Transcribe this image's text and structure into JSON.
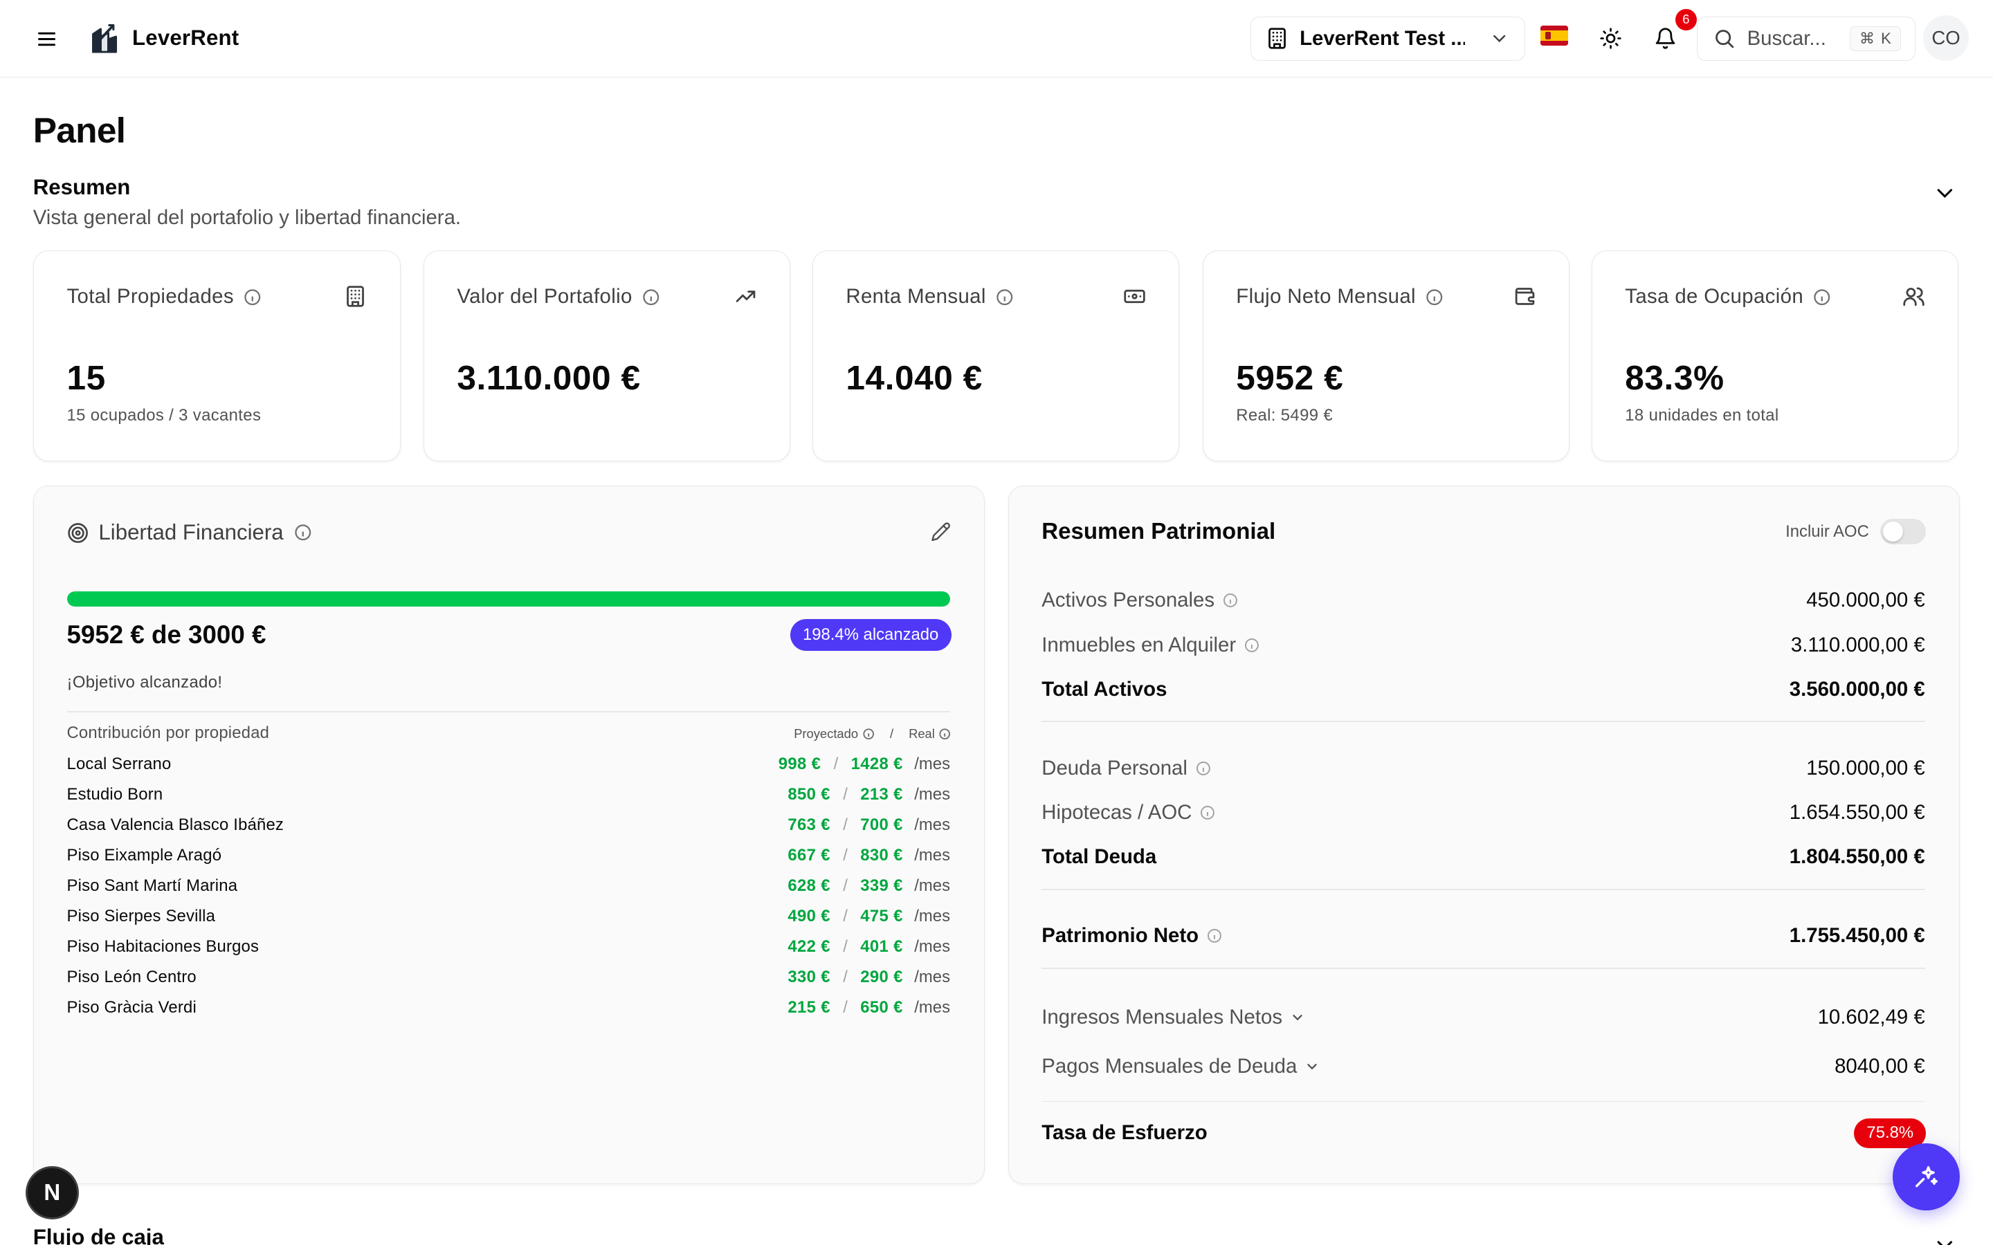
{
  "header": {
    "brand": "LeverRent",
    "org": "LeverRent Test ...",
    "notifications_count": "6",
    "search_placeholder": "Buscar...",
    "shortcut_symbol": "⌘",
    "shortcut_key": "K",
    "avatar_initials": "CO",
    "icons": [
      "menu-icon",
      "logo-icon",
      "building-icon",
      "chevron-down-icon",
      "spain-flag-icon",
      "sun-icon",
      "bell-icon",
      "search-icon"
    ]
  },
  "page": {
    "title": "Panel",
    "summary_title": "Resumen",
    "summary_subtitle": "Vista general del portafolio y libertad financiera."
  },
  "cards": [
    {
      "label": "Total Propiedades",
      "value": "15",
      "sub": "15 ocupados / 3 vacantes",
      "icon": "building-icon"
    },
    {
      "label": "Valor del Portafolio",
      "value": "3.110.000 €",
      "sub": "",
      "icon": "trending-up-icon"
    },
    {
      "label": "Renta Mensual",
      "value": "14.040 €",
      "sub": "",
      "icon": "banknote-icon"
    },
    {
      "label": "Flujo Neto Mensual",
      "value": "5952 €",
      "sub": "Real: 5499 €",
      "icon": "wallet-icon"
    },
    {
      "label": "Tasa de Ocupación",
      "value": "83.3%",
      "sub": "18 unidades en total",
      "icon": "users-icon"
    }
  ],
  "financial_freedom": {
    "title": "Libertad Financiera",
    "progress_fraction": 1.0,
    "amount": "5952 € de 3000 €",
    "badge": "198.4% alcanzado",
    "message": "¡Objetivo alcanzado!",
    "contrib_title": "Contribución por propiedad",
    "legend_projected": "Proyectado",
    "legend_sep": "/",
    "legend_real": "Real",
    "per": "/mes",
    "rows": [
      {
        "name": "Local Serrano",
        "projected": "998 €",
        "real": "1428 €"
      },
      {
        "name": "Estudio Born",
        "projected": "850 €",
        "real": "213 €"
      },
      {
        "name": "Casa Valencia Blasco Ibáñez",
        "projected": "763 €",
        "real": "700 €"
      },
      {
        "name": "Piso Eixample Aragó",
        "projected": "667 €",
        "real": "830 €"
      },
      {
        "name": "Piso Sant Martí Marina",
        "projected": "628 €",
        "real": "339 €"
      },
      {
        "name": "Piso Sierpes Sevilla",
        "projected": "490 €",
        "real": "475 €"
      },
      {
        "name": "Piso Habitaciones Burgos",
        "projected": "422 €",
        "real": "401 €"
      },
      {
        "name": "Piso León Centro",
        "projected": "330 €",
        "real": "290 €"
      },
      {
        "name": "Piso Gràcia Verdi",
        "projected": "215 €",
        "real": "650 €"
      }
    ]
  },
  "patrimony": {
    "title": "Resumen Patrimonial",
    "include_aoc": "Incluir AOC",
    "include_aoc_on": false,
    "personal_assets_label": "Activos Personales",
    "personal_assets": "450.000,00 €",
    "rental_label": "Inmuebles en Alquiler",
    "rental": "3.110.000,00 €",
    "total_assets_label": "Total Activos",
    "total_assets": "3.560.000,00 €",
    "personal_debt_label": "Deuda Personal",
    "personal_debt": "150.000,00 €",
    "mortgages_label": "Hipotecas / AOC",
    "mortgages": "1.654.550,00 €",
    "total_debt_label": "Total Deuda",
    "total_debt": "1.804.550,00 €",
    "net_worth_label": "Patrimonio Neto",
    "net_worth": "1.755.450,00 €",
    "net_income_label": "Ingresos Mensuales Netos",
    "net_income": "10.602,49 €",
    "debt_payments_label": "Pagos Mensuales de Deuda",
    "debt_payments": "8040,00 €",
    "effort_label": "Tasa de Esfuerzo",
    "effort": "75.8%"
  },
  "footer": {
    "next_badge": "N",
    "next_section": "Flujo de caja"
  },
  "colors": {
    "accent": "#4f39f6",
    "success": "#00c951",
    "success_text": "#00a63e",
    "danger": "#e7000b",
    "border": "#e5e7eb"
  }
}
